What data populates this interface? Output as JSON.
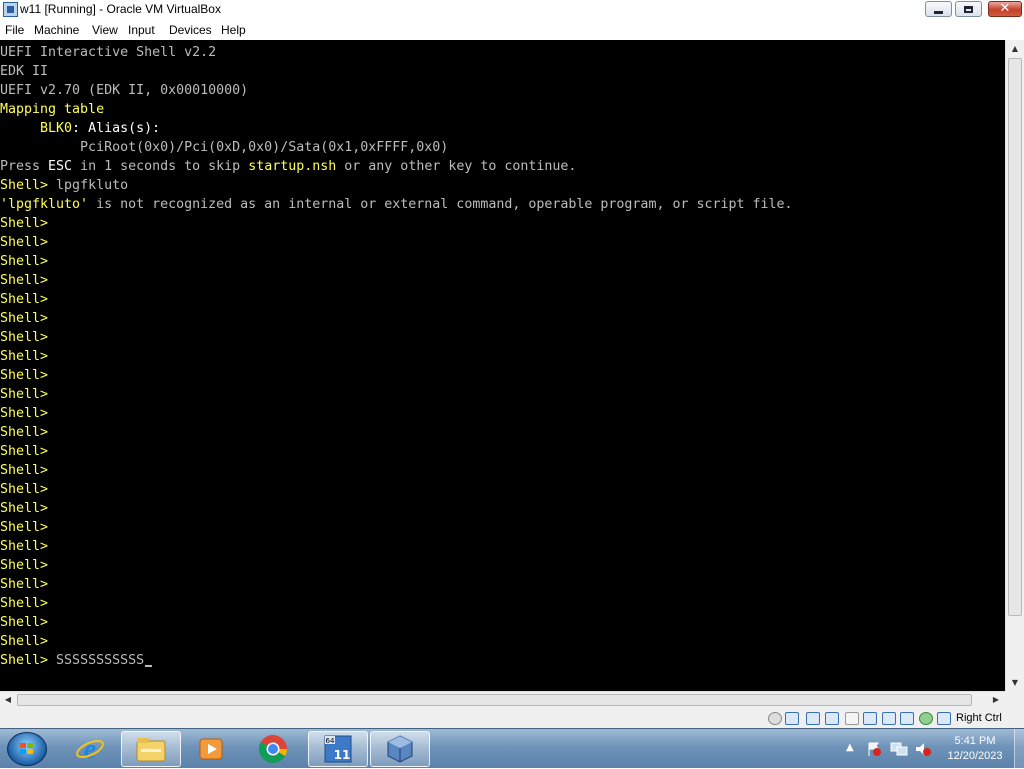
{
  "window": {
    "title": "w11 [Running] - Oracle VM VirtualBox"
  },
  "menu": [
    "File",
    "Machine",
    "View",
    "Input",
    "Devices",
    "Help"
  ],
  "console": {
    "lines": [
      [
        {
          "t": "UEFI Interactive Shell v2.2",
          "c": "g"
        }
      ],
      [
        {
          "t": "EDK II",
          "c": "g"
        }
      ],
      [
        {
          "t": "UEFI v2.70 (EDK II, 0x00010000)",
          "c": "g"
        }
      ],
      [
        {
          "t": "Mapping table",
          "c": "y"
        }
      ],
      [
        {
          "t": "     ",
          "c": "g"
        },
        {
          "t": "BLK0",
          "c": "y"
        },
        {
          "t": ": Alias(s):",
          "c": "w"
        }
      ],
      [
        {
          "t": "          PciRoot(0x0)/Pci(0xD,0x0)/Sata(0x1,0xFFFF,0x0)",
          "c": "g"
        }
      ],
      [
        {
          "t": "Press ",
          "c": "g"
        },
        {
          "t": "ESC",
          "c": "w"
        },
        {
          "t": " in 1 seconds to skip ",
          "c": "g"
        },
        {
          "t": "startup.nsh",
          "c": "y"
        },
        {
          "t": " or any other key to continue.",
          "c": "g"
        }
      ],
      [
        {
          "t": "Shell> ",
          "c": "y"
        },
        {
          "t": "lpgfkluto",
          "c": "g"
        }
      ],
      [
        {
          "t": "'lpgfkluto'",
          "c": "y"
        },
        {
          "t": " is not recognized as an internal or external command, operable program, or script file.",
          "c": "g"
        }
      ],
      [
        {
          "t": "Shell>",
          "c": "y"
        }
      ],
      [
        {
          "t": "Shell>",
          "c": "y"
        }
      ],
      [
        {
          "t": "Shell>",
          "c": "y"
        }
      ],
      [
        {
          "t": "Shell>",
          "c": "y"
        }
      ],
      [
        {
          "t": "Shell>",
          "c": "y"
        }
      ],
      [
        {
          "t": "Shell>",
          "c": "y"
        }
      ],
      [
        {
          "t": "Shell>",
          "c": "y"
        }
      ],
      [
        {
          "t": "Shell>",
          "c": "y"
        }
      ],
      [
        {
          "t": "Shell>",
          "c": "y"
        }
      ],
      [
        {
          "t": "Shell>",
          "c": "y"
        }
      ],
      [
        {
          "t": "Shell>",
          "c": "y"
        }
      ],
      [
        {
          "t": "Shell>",
          "c": "y"
        }
      ],
      [
        {
          "t": "Shell>",
          "c": "y"
        }
      ],
      [
        {
          "t": "Shell>",
          "c": "y"
        }
      ],
      [
        {
          "t": "Shell>",
          "c": "y"
        }
      ],
      [
        {
          "t": "Shell>",
          "c": "y"
        }
      ],
      [
        {
          "t": "Shell>",
          "c": "y"
        }
      ],
      [
        {
          "t": "Shell>",
          "c": "y"
        }
      ],
      [
        {
          "t": "Shell>",
          "c": "y"
        }
      ],
      [
        {
          "t": "Shell>",
          "c": "y"
        }
      ],
      [
        {
          "t": "Shell>",
          "c": "y"
        }
      ],
      [
        {
          "t": "Shell>",
          "c": "y"
        }
      ],
      [
        {
          "t": "Shell>",
          "c": "y"
        }
      ],
      [
        {
          "t": "Shell> ",
          "c": "y"
        },
        {
          "t": "SSSSSSSSSSS",
          "c": "g"
        }
      ]
    ]
  },
  "status_bar": {
    "host_key": "Right Ctrl",
    "icons": [
      "hard-disk-icon",
      "optical-drive-icon",
      "audio-icon",
      "network-icon",
      "usb-icon",
      "shared-folders-icon",
      "display-icon",
      "video-capture-icon",
      "cpu-icon",
      "mouse-integration-icon",
      "keyboard-icon"
    ]
  },
  "taskbar": {
    "apps": [
      "internet-explorer-icon",
      "file-explorer-icon",
      "media-player-icon",
      "chrome-icon",
      "windows-11-media-icon",
      "virtualbox-icon"
    ],
    "clock_time": "5:41 PM",
    "clock_date": "12/20/2023"
  },
  "colors": {
    "console_bg": "#000000",
    "console_yellow": "#ffff55",
    "console_gray": "#bcbcbc",
    "console_white": "#ffffff"
  }
}
